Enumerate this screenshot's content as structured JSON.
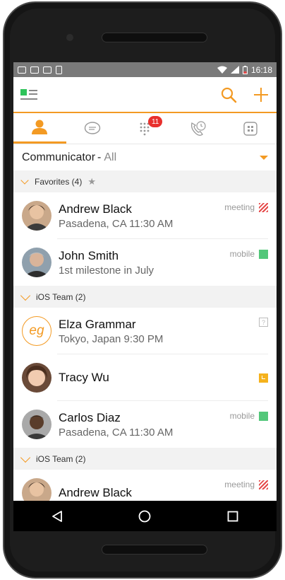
{
  "status_bar": {
    "time": "16:18"
  },
  "header": {
    "logo_icon": "app-logo-icon",
    "actions": [
      {
        "name": "search-icon"
      },
      {
        "name": "add-icon"
      }
    ]
  },
  "tabs": [
    {
      "name": "contacts-tab",
      "icon": "person-icon",
      "active": true
    },
    {
      "name": "chat-tab",
      "icon": "chat-bubble-icon"
    },
    {
      "name": "dialpad-tab",
      "icon": "dialpad-icon",
      "badge": "11"
    },
    {
      "name": "call-history-tab",
      "icon": "phone-history-icon"
    },
    {
      "name": "apps-tab",
      "icon": "apps-icon"
    }
  ],
  "filter": {
    "title": "Communicator",
    "separator": "-",
    "value": "All"
  },
  "groups": {
    "favorites": {
      "label": "Favorites (4)"
    },
    "ios1": {
      "label": "iOS Team (2)"
    },
    "ios2": {
      "label": "iOS Team (2)"
    }
  },
  "contacts": {
    "andrew1": {
      "name": "Andrew Black",
      "sub": "Pasadena, CA 11:30 AM",
      "status": "meeting"
    },
    "john": {
      "name": "John Smith",
      "sub": "1st milestone in July",
      "status": "mobile"
    },
    "elza": {
      "name": "Elza Grammar",
      "sub": "Tokyo, Japan 9:30 PM",
      "initials": "eg",
      "status_unknown": "?"
    },
    "tracy": {
      "name": "Tracy Wu"
    },
    "carlos": {
      "name": "Carlos Diaz",
      "sub": "Pasadena, CA 11:30 AM",
      "status": "mobile"
    },
    "andrew2": {
      "name": "Andrew Black",
      "status": "meeting"
    }
  },
  "colors": {
    "accent": "#f39a23",
    "mobile": "#53c77a",
    "meeting": "#e54a4a",
    "badge": "#e8302d",
    "away": "#f5b21d"
  }
}
